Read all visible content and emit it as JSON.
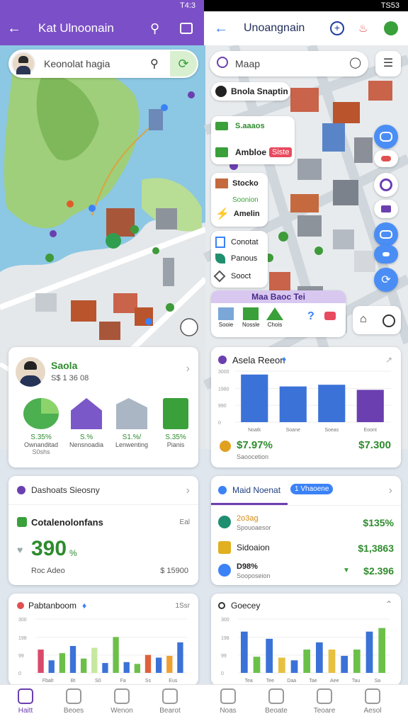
{
  "left": {
    "status_time": "T4:3",
    "title": "Kat Ulnoonain",
    "search_placeholder": "Keonolat hagia",
    "person_card": {
      "name": "Saola",
      "sub": "S$ 1 36 08",
      "stats": [
        {
          "value": "S.35%",
          "label": "Ownanditad",
          "extra": "S0shs"
        },
        {
          "value": "S.%",
          "label": "Nensnoadia"
        },
        {
          "value": "S1.%/",
          "label": "Lenwenting"
        },
        {
          "value": "S.35%",
          "label": "Pianis"
        }
      ]
    },
    "stat_card": {
      "header": "Dashoats Sieosny",
      "title": "Cotalenolonfans",
      "side": "Eal",
      "big": "390",
      "unit": "%",
      "sub_label": "Roc Adeo",
      "sub_value": "$ 15900"
    },
    "chart_card": {
      "title": "Pabtanboom",
      "side": "1Ssr"
    }
  },
  "right": {
    "status_time": "TS53",
    "title": "Unoangnain",
    "search_placeholder": "Maap",
    "place_label": "Bnola Snaptin",
    "list1": [
      {
        "label": "S.aaaos"
      },
      {
        "label": "Ambloe",
        "tag": "Siste"
      }
    ],
    "list2": [
      {
        "label": "Stocko"
      },
      {
        "label": "Soonion"
      },
      {
        "label": "Amelin"
      }
    ],
    "list3": [
      {
        "label": "Conotat"
      },
      {
        "label": "Panous"
      },
      {
        "label": "Sooct"
      }
    ],
    "banner_label": "Maa Baoc Tei",
    "banner_items": [
      "Sooie",
      "Nossle",
      "Chois"
    ],
    "chart_card1": {
      "title": "Asela Reeon",
      "cats": [
        "Noatk",
        "Soane",
        "Soeas",
        "Eoont"
      ],
      "left_value": "$7.97%",
      "left_sub": "Saoocetion",
      "right_value": "$7.300"
    },
    "market_card": {
      "tab": "Maid Noenat",
      "badge": "1 Vhaoene",
      "rows": [
        {
          "label": "2o3ag",
          "sub": "Spouoaesor",
          "value": "$135%"
        },
        {
          "label": "Sidoaion",
          "sub": "",
          "value": "$1,3863"
        },
        {
          "label": "D98%",
          "sub": "Sooposeion",
          "value": "$2.396"
        }
      ]
    },
    "chart_card2": {
      "title": "Goecey"
    }
  },
  "nav_left": [
    "Haitt",
    "Beoes",
    "Wenon",
    "Bearot"
  ],
  "nav_right": [
    "Noas",
    "Beoate",
    "Teoare",
    "Aesol"
  ],
  "chart_data": [
    {
      "type": "bar",
      "title": "Asela Reeon",
      "categories": [
        "Noatk",
        "Soane",
        "Soeas",
        "Eoont"
      ],
      "ylim": [
        0,
        3000
      ],
      "series": [
        {
          "values": [
            2800,
            2100,
            2200,
            1900
          ]
        }
      ]
    },
    {
      "type": "bar",
      "title": "Pabtanboom",
      "categories": [
        "Fbalt",
        "Bt",
        "S0",
        "Fa",
        "Ss",
        "Eus"
      ],
      "ylim": [
        0,
        300
      ],
      "series": [
        {
          "values": [
            130,
            70,
            110,
            150,
            80,
            140,
            55,
            200,
            60,
            50,
            100,
            85,
            95,
            170
          ]
        }
      ]
    },
    {
      "type": "bar",
      "title": "Goecey",
      "categories": [
        "Tea",
        "Tee",
        "Daa",
        "Tae",
        "Aee",
        "Tau",
        "Sa"
      ],
      "ylim": [
        0,
        300
      ],
      "series": [
        {
          "values": [
            230,
            90,
            190,
            85,
            70,
            130,
            170,
            130,
            95,
            130,
            230,
            250
          ]
        }
      ]
    }
  ],
  "colors": {
    "left_appbar": "#7b4fc7",
    "accent_green": "#3aa03a",
    "accent_blue": "#3b82f6",
    "accent_purple": "#6b3fb0"
  }
}
